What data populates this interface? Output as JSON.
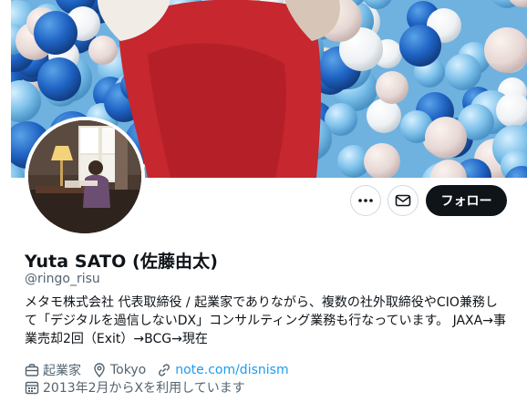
{
  "profile": {
    "name": "Yuta SATO (佐藤由太)",
    "handle": "@ringo_risu",
    "bio": [
      "メタモ株式会社 代表取締役 / 起業家でありながら、複数の社外取締役やCIO兼務し",
      "て「デジタルを過信しないDX」コンサルティング業務も行なっています。 JAXA→事",
      "業売却2回（Exit）→BCG→現在"
    ],
    "profession": "起業家",
    "location": "Tokyo",
    "website": "note.com/disnism",
    "joined": "2013年2月からXを利用しています"
  },
  "actions": {
    "more_icon": "more-dots-icon",
    "message_icon": "envelope-icon",
    "follow_label": "フォロー"
  },
  "colors": {
    "link": "#1d9bf0",
    "secondary_text": "#536471",
    "follow_button_bg": "#0f1419"
  }
}
